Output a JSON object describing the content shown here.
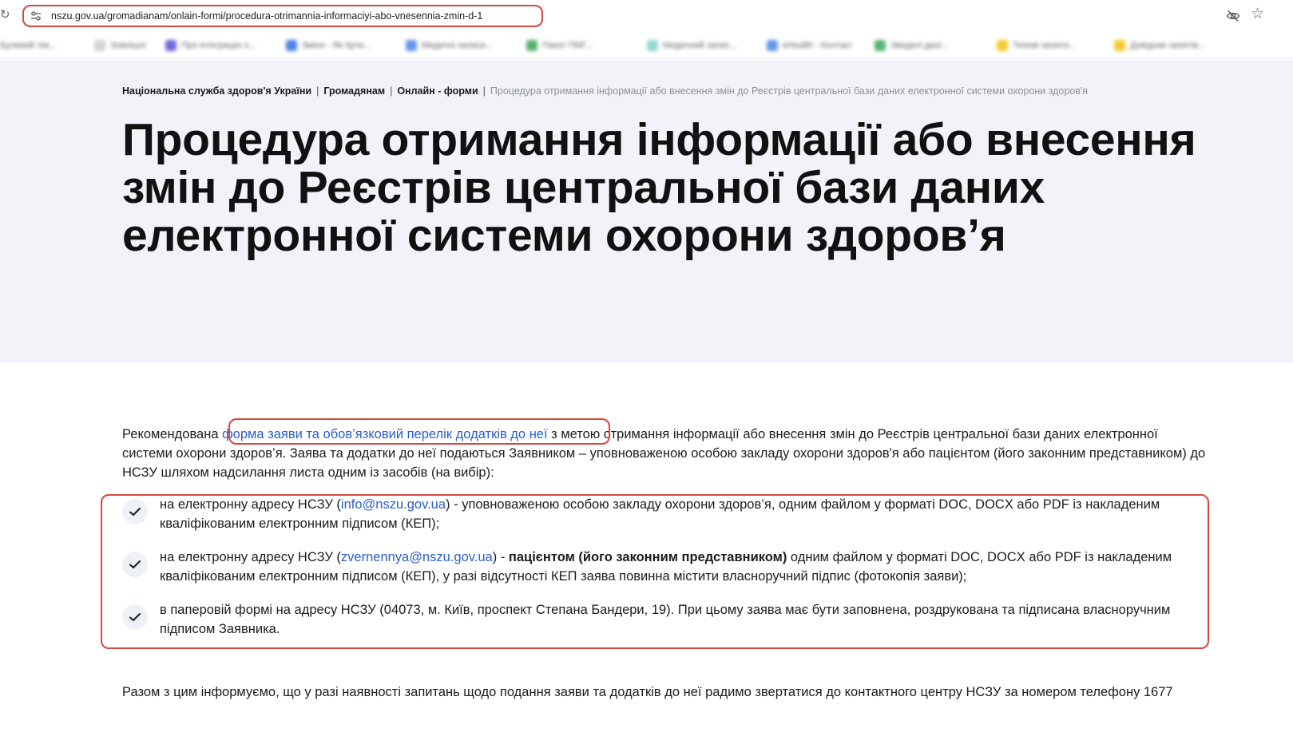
{
  "browser": {
    "url": "nszu.gov.ua/gromadianam/onlain-formi/procedura-otrimannia-informaciyi-abo-vnesennia-zmin-d-1",
    "bookmarks": [
      {
        "label": "Булевий тек...",
        "color": "#bbbbbb"
      },
      {
        "label": "Зовнішні",
        "color": "#cccccc"
      },
      {
        "label": "Про інтеграцію з...",
        "color": "#5a4fcf"
      },
      {
        "label": "Зміни - Як бути...",
        "color": "#2f6fe0"
      },
      {
        "label": "Медичні записи...",
        "color": "#4a86e8"
      },
      {
        "label": "Пакет ПМГ...",
        "color": "#3aa757"
      },
      {
        "label": "Медичний запис...",
        "color": "#7fd1c8"
      },
      {
        "label": "eHealth - Контакт",
        "color": "#4a86e8"
      },
      {
        "label": "Зведені дані...",
        "color": "#3aa757"
      },
      {
        "label": "Типові запити...",
        "color": "#f4c20d"
      },
      {
        "label": "Довідник запитів...",
        "color": "#f4c20d"
      }
    ]
  },
  "breadcrumb": {
    "items": [
      "Національна служба здоров'я України",
      "Громадянам",
      "Онлайн - форми"
    ],
    "separator": "|",
    "current": "Процедура отримання інформації або внесення змін до Реєстрів центральної бази даних електронної системи охорони здоров'я"
  },
  "title": "Процедура отримання інформації або внесення змін до Реєстрів центральної бази даних електронної системи охорони здоров’я",
  "intro": {
    "before_link": "Рекомендована ",
    "link": "форма заяви та обов’язковий перелік додатків до неї",
    "after_link": " з метою отримання інформації або внесення змін до Реєстрів центральної бази даних електронної системи охорони здоров’я. Заява та додатки до неї подаються Заявником – уповноваженою особою закладу охорони здоров'я або пацієнтом (його законним представником) до НСЗУ шляхом надсилання листа одним із засобів (на вибір):"
  },
  "items": [
    {
      "prefix": "на електронну адресу НСЗУ (",
      "email": "info@nszu.gov.ua",
      "middle": ") - уповноваженою особою закладу охорони здоров’я,",
      "bold": "",
      "suffix": " одним файлом у форматі DOC, DOCX або PDF із накладеним кваліфікованим електронним підписом (КЕП);"
    },
    {
      "prefix": "на електронну адресу НСЗУ (",
      "email": "zvernennya@nszu.gov.ua",
      "middle": ") - ",
      "bold": "пацієнтом (його законним представником)",
      "suffix": " одним файлом у форматі DOC, DOCX або PDF із накладеним кваліфікованим електронним підписом (КЕП), у разі відсутності КЕП заява повинна містити власноручний підпис (фотокопія заяви);"
    },
    {
      "prefix": "в паперовій формі на адресу НСЗУ (04073, м. Київ, проспект Степана Бандери, 19). При цьому заява має бути заповнена, роздрукована та підписана власноручним підписом Заявника.",
      "email": "",
      "middle": "",
      "bold": "",
      "suffix": ""
    }
  ],
  "footer_text": "Разом з цим інформуємо, що у разі наявності запитань щодо подання заяви та додатків до неї радимо звертатися до контактного центру НСЗУ за номером телефону 1677",
  "colors": {
    "highlight": "#d9473e",
    "link": "#2b5ec9",
    "hero_bg": "#f1f3f8",
    "check_bg": "#eef1f5"
  },
  "icons": {
    "reload": "reload-icon",
    "site_settings": "tune-icon",
    "eye_off": "eye-off-icon",
    "bookmark_star": "star-icon",
    "list_marker": "check-icon"
  }
}
